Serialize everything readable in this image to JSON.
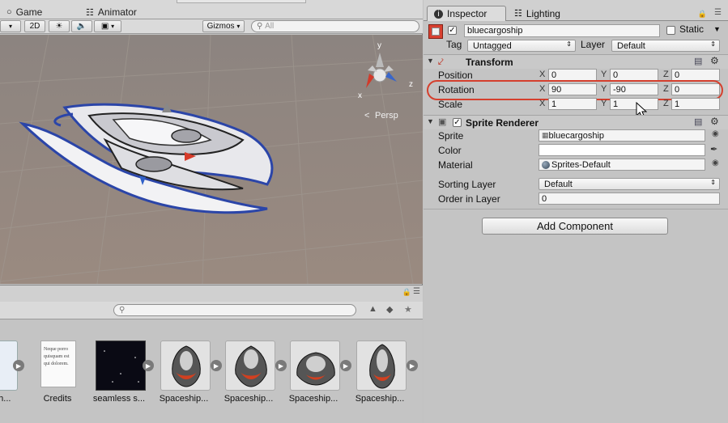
{
  "left_panel": {
    "tabs": [
      {
        "label": "Game",
        "icon": "game-controller-icon"
      },
      {
        "label": "Animator",
        "icon": "animator-grid-icon"
      }
    ],
    "toolbar": {
      "mode_2d": "2D",
      "gizmos": "Gizmos",
      "search_placeholder": "All"
    },
    "scene": {
      "projection_label": "Persp",
      "gizmo_axes": {
        "x": "x",
        "y": "y",
        "z": "z"
      }
    },
    "project": {
      "assets": [
        {
          "label": "osh..."
        },
        {
          "label": "Credits"
        },
        {
          "label": "seamless s..."
        },
        {
          "label": "Spaceship..."
        },
        {
          "label": "Spaceship..."
        },
        {
          "label": "Spaceship..."
        },
        {
          "label": "Spaceship..."
        }
      ],
      "credits_preview": "Neque porro quisquam est qui dolorem."
    }
  },
  "inspector": {
    "tabs": [
      {
        "label": "Inspector",
        "icon": "info-icon"
      },
      {
        "label": "Lighting",
        "icon": "lighting-icon"
      }
    ],
    "object": {
      "name": "bluecargoship",
      "active": true,
      "static_label": "Static",
      "tag_label": "Tag",
      "tag_value": "Untagged",
      "layer_label": "Layer",
      "layer_value": "Default"
    },
    "transform": {
      "title": "Transform",
      "position": {
        "label": "Position",
        "x": "0",
        "y": "0",
        "z": "0"
      },
      "rotation": {
        "label": "Rotation",
        "x": "90",
        "y": "-90",
        "z": "0"
      },
      "scale": {
        "label": "Scale",
        "x": "1",
        "y": "1",
        "z": "1"
      }
    },
    "sprite_renderer": {
      "title": "Sprite Renderer",
      "enabled": true,
      "sprite_label": "Sprite",
      "sprite_value": "bluecargoship",
      "color_label": "Color",
      "material_label": "Material",
      "material_value": "Sprites-Default",
      "sorting_layer_label": "Sorting Layer",
      "sorting_layer_value": "Default",
      "order_label": "Order in Layer",
      "order_value": "0"
    },
    "add_component": "Add Component"
  },
  "colors": {
    "highlight": "#d5402e",
    "scene_bg": "#908078",
    "ship_outline": "#3050b8"
  }
}
